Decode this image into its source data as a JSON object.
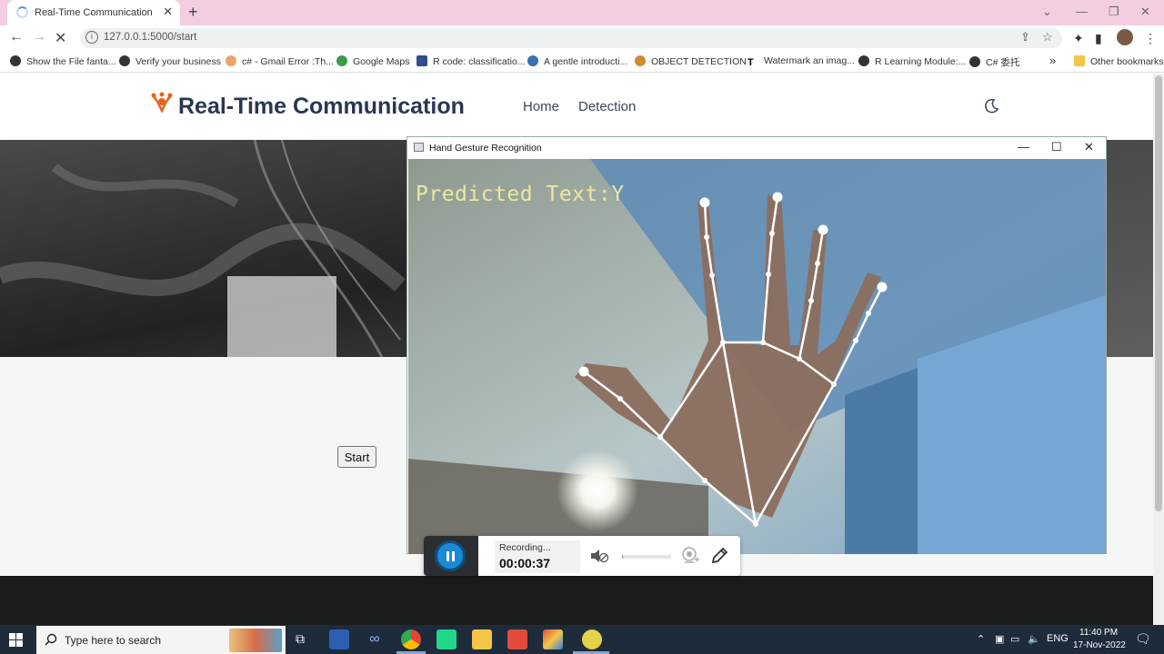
{
  "browser": {
    "tab_title": "Real-Time Communication",
    "tab_close": "✕",
    "new_tab": "+",
    "url": "127.0.0.1:5000/start",
    "bookmarks": [
      "Show the File fanta...",
      "Verify your business",
      "c# - Gmail Error :Th...",
      "Google Maps",
      "R code: classificatio...",
      "A gentle introducti...",
      "OBJECT DETECTION...",
      "Watermark an imag...",
      "R Learning Module:...",
      "C# 委托"
    ],
    "bookmarks_overflow": "»",
    "other_bookmarks": "Other bookmarks"
  },
  "site": {
    "brand": "Real-Time Communication",
    "nav": {
      "home": "Home",
      "detection": "Detection"
    },
    "start_button": "Start"
  },
  "gesture_window": {
    "title": "Hand Gesture Recognition",
    "predicted_text": "Predicted Text:Y"
  },
  "recorder": {
    "status": "Recording...",
    "elapsed": "00:00:37"
  },
  "taskbar": {
    "search_placeholder": "Type here to search",
    "language": "ENG",
    "time": "11:40 PM",
    "date": "17-Nov-2022"
  },
  "colors": {
    "tabbar": "#f4cde0",
    "brand_text": "#2b3654",
    "logo_orange": "#e8631a",
    "predicted_text": "#f0e6a0",
    "record_blue": "#1a8ad6",
    "taskbar": "#1e2b3b"
  }
}
